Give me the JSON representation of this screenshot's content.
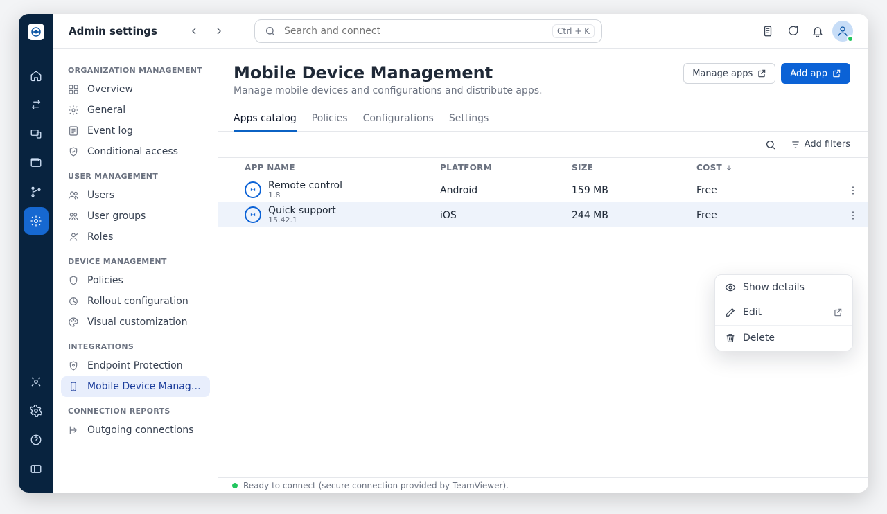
{
  "app": {
    "title": "Admin settings"
  },
  "search": {
    "placeholder": "Search and connect",
    "shortcut": "Ctrl + K"
  },
  "rail_icons": [
    "home",
    "swap",
    "devices",
    "wallet",
    "branches",
    "gear"
  ],
  "rail_bottom_icons": [
    "plug",
    "settings",
    "help",
    "panel"
  ],
  "sidebar": {
    "sections": [
      {
        "label": "ORGANIZATION MANAGEMENT",
        "items": [
          {
            "icon": "dashboard",
            "label": "Overview"
          },
          {
            "icon": "gear",
            "label": "General"
          },
          {
            "icon": "log",
            "label": "Event log"
          },
          {
            "icon": "lock",
            "label": "Conditional access"
          }
        ]
      },
      {
        "label": "USER MANAGEMENT",
        "items": [
          {
            "icon": "users",
            "label": "Users"
          },
          {
            "icon": "groups",
            "label": "User groups"
          },
          {
            "icon": "roles",
            "label": "Roles"
          }
        ]
      },
      {
        "label": "DEVICE MANAGEMENT",
        "items": [
          {
            "icon": "shield",
            "label": "Policies"
          },
          {
            "icon": "rollout",
            "label": "Rollout configuration"
          },
          {
            "icon": "palette",
            "label": "Visual customization"
          }
        ]
      },
      {
        "label": "INTEGRATIONS",
        "items": [
          {
            "icon": "shield2",
            "label": "Endpoint Protection"
          },
          {
            "icon": "mdm",
            "label": "Mobile Device Managem…",
            "active": true
          }
        ]
      },
      {
        "label": "CONNECTION REPORTS",
        "items": [
          {
            "icon": "out",
            "label": "Outgoing connections"
          }
        ]
      }
    ]
  },
  "page": {
    "title": "Mobile Device Management",
    "subtitle": "Manage mobile devices and configurations and distribute apps.",
    "actions": {
      "manage_apps": "Manage apps",
      "add_app": "Add app"
    }
  },
  "tabs": [
    "Apps catalog",
    "Policies",
    "Configurations",
    "Settings"
  ],
  "active_tab": 0,
  "filters_label": "Add filters",
  "table": {
    "columns": [
      "APP NAME",
      "PLATFORM",
      "SIZE",
      "COST"
    ],
    "sort_col": 3,
    "rows": [
      {
        "name": "Remote control",
        "version": "1.8",
        "platform": "Android",
        "size": "159 MB",
        "cost": "Free"
      },
      {
        "name": "Quick support",
        "version": "15.42.1",
        "platform": "iOS",
        "size": "244 MB",
        "cost": "Free",
        "selected": true
      }
    ]
  },
  "dropdown": {
    "show": "Show details",
    "edit": "Edit",
    "delete": "Delete"
  },
  "status": "Ready to connect (secure connection provided by TeamViewer)."
}
